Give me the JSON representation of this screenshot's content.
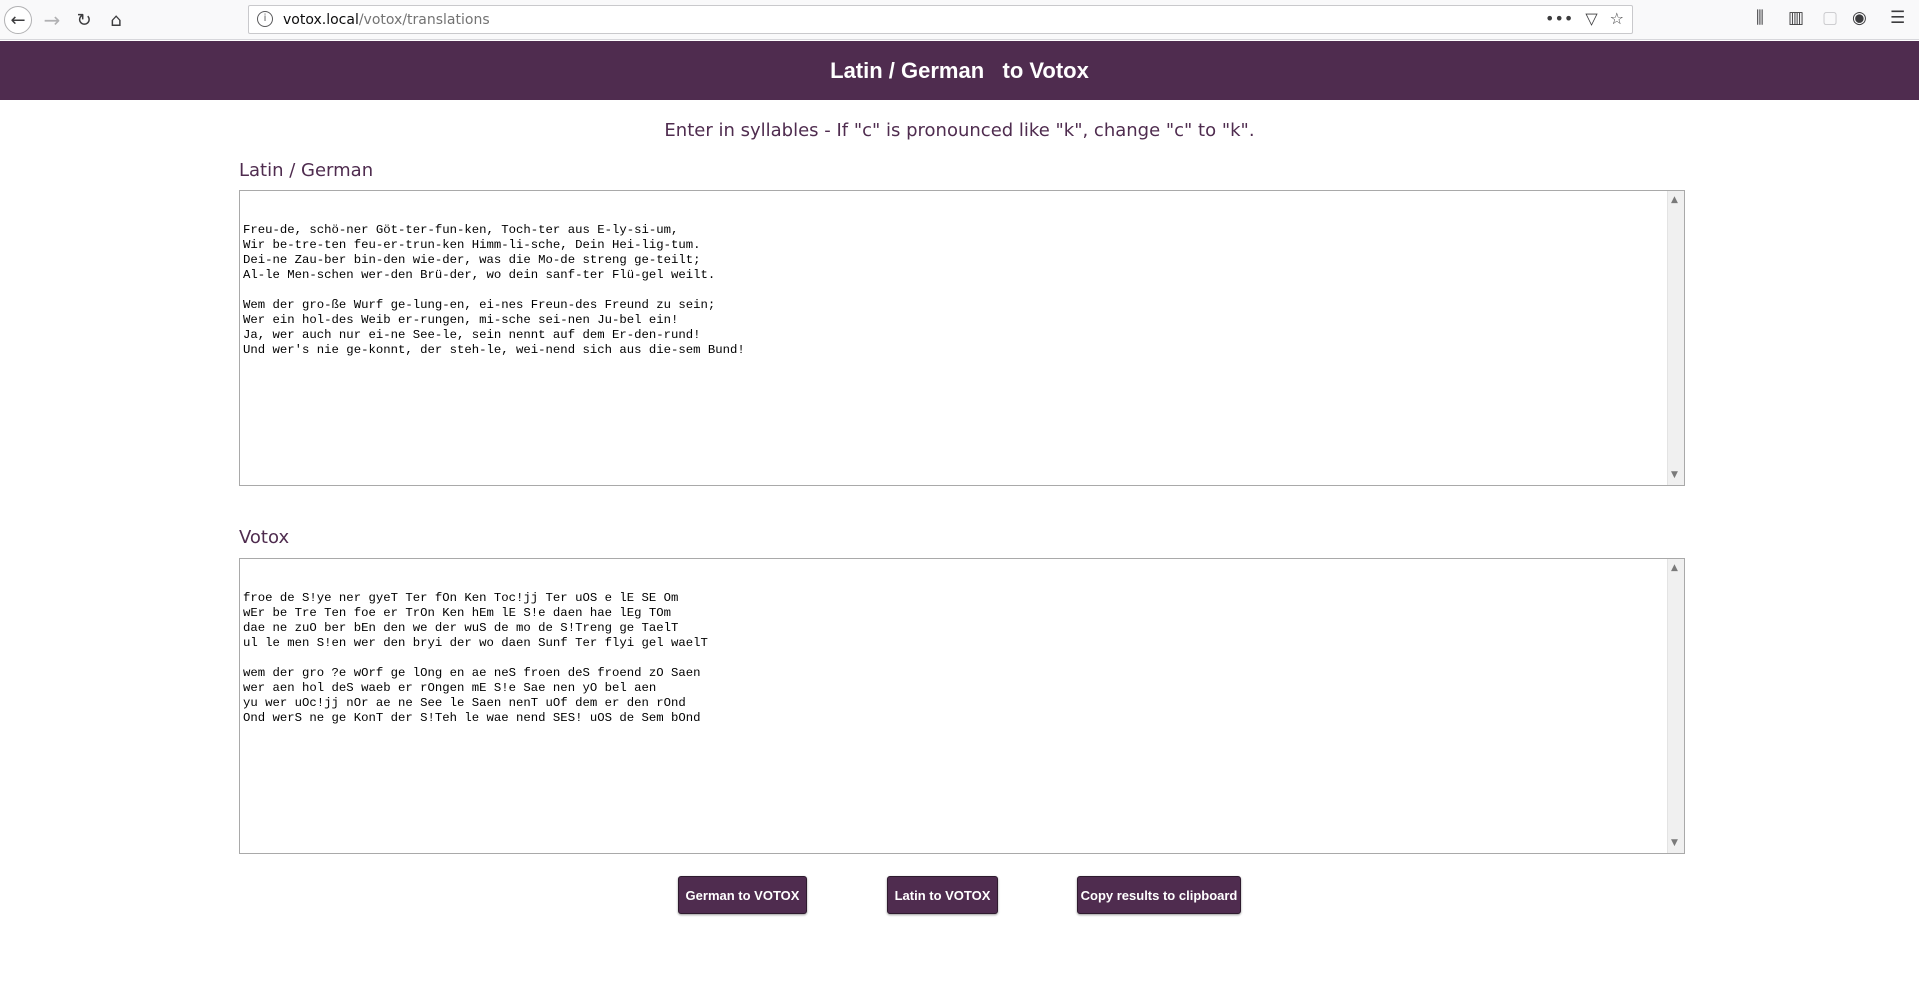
{
  "browser": {
    "url_host": "votox.local",
    "url_path": "/votox/translations"
  },
  "header": {
    "title": "Latin / German   to Votox"
  },
  "instructions": "Enter in syllables - If \"c\" is pronounced like \"k\", change \"c\" to \"k\".",
  "input_section": {
    "label": "Latin / German",
    "lines": [
      "Freu-de, schö-ner Göt-ter-fun-ken, Toch-ter aus E-ly-si-um,",
      "Wir be-tre-ten feu-er-trun-ken Himm-li-sche, Dein Hei-lig-tum.",
      "Dei-ne Zau-ber bin-den wie-der, was die Mo-de streng ge-teilt;",
      "Al-le Men-schen wer-den Brü-der, wo dein sanf-ter Flü-gel weilt.",
      "",
      "Wem der gro-ße Wurf ge-lung-en, ei-nes Freun-des Freund zu sein;",
      "Wer ein hol-des Weib er-rungen, mi-sche sei-nen Ju-bel ein!",
      "Ja, wer auch nur ei-ne See-le, sein nennt auf dem Er-den-rund!",
      "Und wer's nie ge-konnt, der steh-le, wei-nend sich aus die-sem Bund!"
    ]
  },
  "output_section": {
    "label": "Votox",
    "lines": [
      "froe de S!ye ner gyeT Ter fOn Ken Toc!jj Ter uOS e lE SE Om",
      "wEr be Tre Ten foe er TrOn Ken hEm lE S!e daen hae lEg TOm",
      "dae ne zuO ber bEn den we der wuS de mo de S!Treng ge TaelT",
      "ul le men S!en wer den bryi der wo daen Sunf Ter flyi gel waelT",
      "",
      "wem der gro ?e wOrf ge lOng en ae neS froen deS froend zO Saen",
      "wer aen hol deS waeb er rOngen mE S!e Sae nen yO bel aen",
      "yu wer uOc!jj nOr ae ne See le Saen nenT uOf dem er den rOnd",
      "Ond werS ne ge KonT der S!Teh le wae nend SES! uOS de Sem bOnd"
    ]
  },
  "buttons": {
    "german": "German to VOTOX",
    "latin": "Latin to VOTOX",
    "copy": "Copy results to clipboard"
  }
}
